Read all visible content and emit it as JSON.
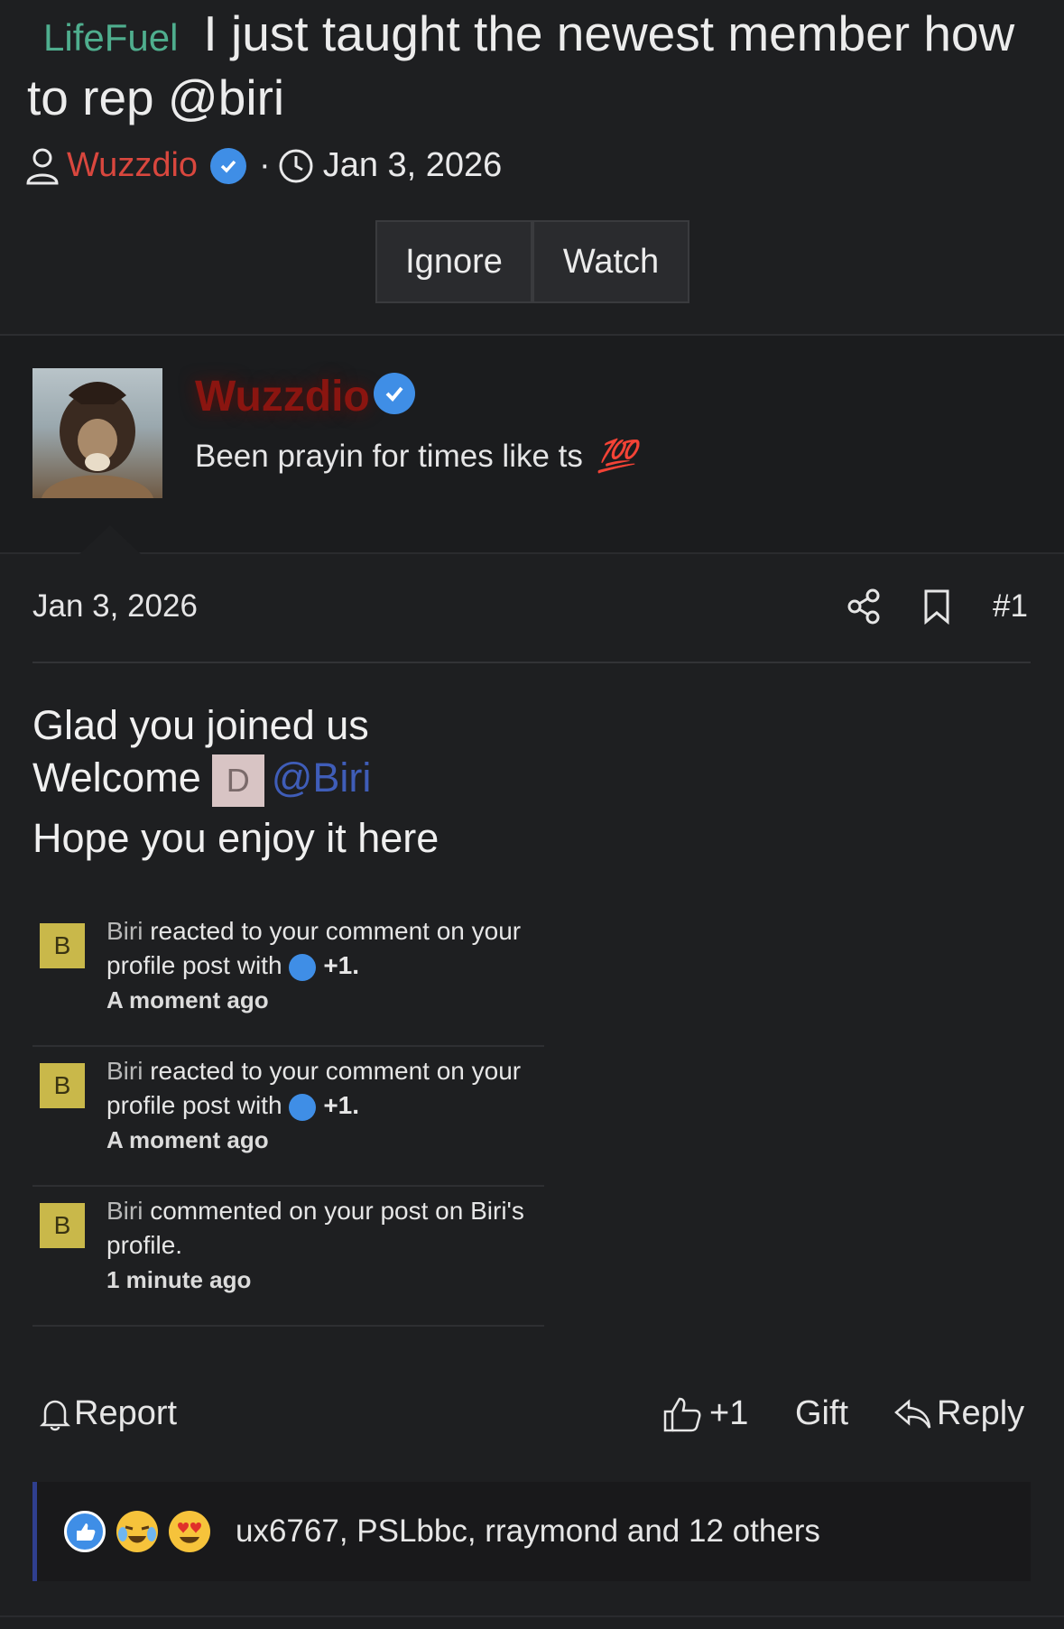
{
  "thread": {
    "prefix": "LifeFuel",
    "title_line1": "I just taught the newest member how",
    "title_line2": "to rep @biri",
    "author": "Wuzzdio",
    "separator": "·",
    "date": "Jan 3, 2026"
  },
  "buttons": {
    "ignore": "Ignore",
    "watch": "Watch"
  },
  "user": {
    "name": "Wuzzdio",
    "status": "Been prayin for times like ts",
    "status_emoji": "💯"
  },
  "post": {
    "date": "Jan 3, 2026",
    "number": "#1",
    "line1": "Glad you joined us",
    "line2": "Welcome",
    "mention_badge": "D",
    "mention": "@Biri",
    "line3": "Hope you enjoy it here"
  },
  "notifications": [
    {
      "badge": "B",
      "user": "Biri",
      "text_a": " reacted to your comment on your profile post with ",
      "reaction": "+1.",
      "time": "A moment ago"
    },
    {
      "badge": "B",
      "user": "Biri",
      "text_a": " reacted to your comment on your profile post with ",
      "reaction": "+1.",
      "time": "A moment ago"
    },
    {
      "badge": "B",
      "user": "Biri",
      "text_a": " commented on your post on Biri's profile.",
      "reaction": "",
      "time": "1 minute ago"
    }
  ],
  "actions": {
    "report": "Report",
    "like": "+1",
    "gift": "Gift",
    "reply": "Reply"
  },
  "reactions": {
    "summary": "ux6767, PSLbbc, rraymond and 12 others"
  },
  "colors": {
    "prefix": "#4fae8e",
    "author": "#d9473e",
    "verified": "#3f8ee6",
    "mention": "#3f5db8",
    "notif_badge": "#c9b84a"
  }
}
